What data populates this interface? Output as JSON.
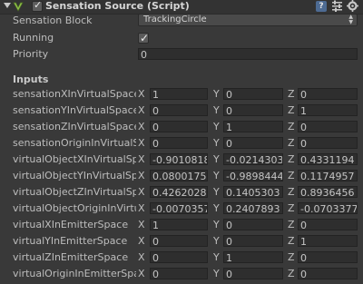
{
  "component": {
    "title": "Sensation Source (Script)",
    "enabled": true,
    "help_glyph": "?"
  },
  "props": {
    "sensation_block_label": "Sensation Block",
    "sensation_block_value": "TrackingCircle",
    "running_label": "Running",
    "running_checked": true,
    "priority_label": "Priority",
    "priority_value": "0"
  },
  "inputs": {
    "heading": "Inputs",
    "rows": [
      {
        "label": "sensationXInVirtualSpace",
        "x": "1",
        "y": "0",
        "z": "0"
      },
      {
        "label": "sensationYInVirtualSpace",
        "x": "0",
        "y": "0",
        "z": "1"
      },
      {
        "label": "sensationZInVirtualSpace",
        "x": "0",
        "y": "1",
        "z": "0"
      },
      {
        "label": "sensationOriginInVirtualS",
        "x": "0",
        "y": "0",
        "z": "0"
      },
      {
        "label": "virtualObjectXInVirtualSp",
        "x": "-0.9010818",
        "y": "-0.0214303",
        "z": "0.4331194"
      },
      {
        "label": "virtualObjectYInVirtualSp",
        "x": "0.0800175",
        "y": "-0.9898444",
        "z": "0.1174957"
      },
      {
        "label": "virtualObjectZInVirtualSp",
        "x": "0.4262028",
        "y": "0.1405303",
        "z": "0.8936456"
      },
      {
        "label": "virtualObjectOriginInVirtu",
        "x": "-0.0070357",
        "y": "0.2407893",
        "z": "-0.0703377"
      },
      {
        "label": "virtualXInEmitterSpace",
        "x": "1",
        "y": "0",
        "z": "0"
      },
      {
        "label": "virtualYInEmitterSpace",
        "x": "0",
        "y": "0",
        "z": "1"
      },
      {
        "label": "virtualZInEmitterSpace",
        "x": "0",
        "y": "1",
        "z": "0"
      },
      {
        "label": "virtualOriginInEmitterSpa",
        "x": "0",
        "y": "0",
        "z": "0"
      }
    ]
  },
  "axis_labels": {
    "x": "X",
    "y": "Y",
    "z": "Z"
  },
  "colors": {
    "background": "#393939",
    "field_bg": "#2e2e2e",
    "text": "#bdbdbd",
    "help_icon": "#4d6b93"
  }
}
